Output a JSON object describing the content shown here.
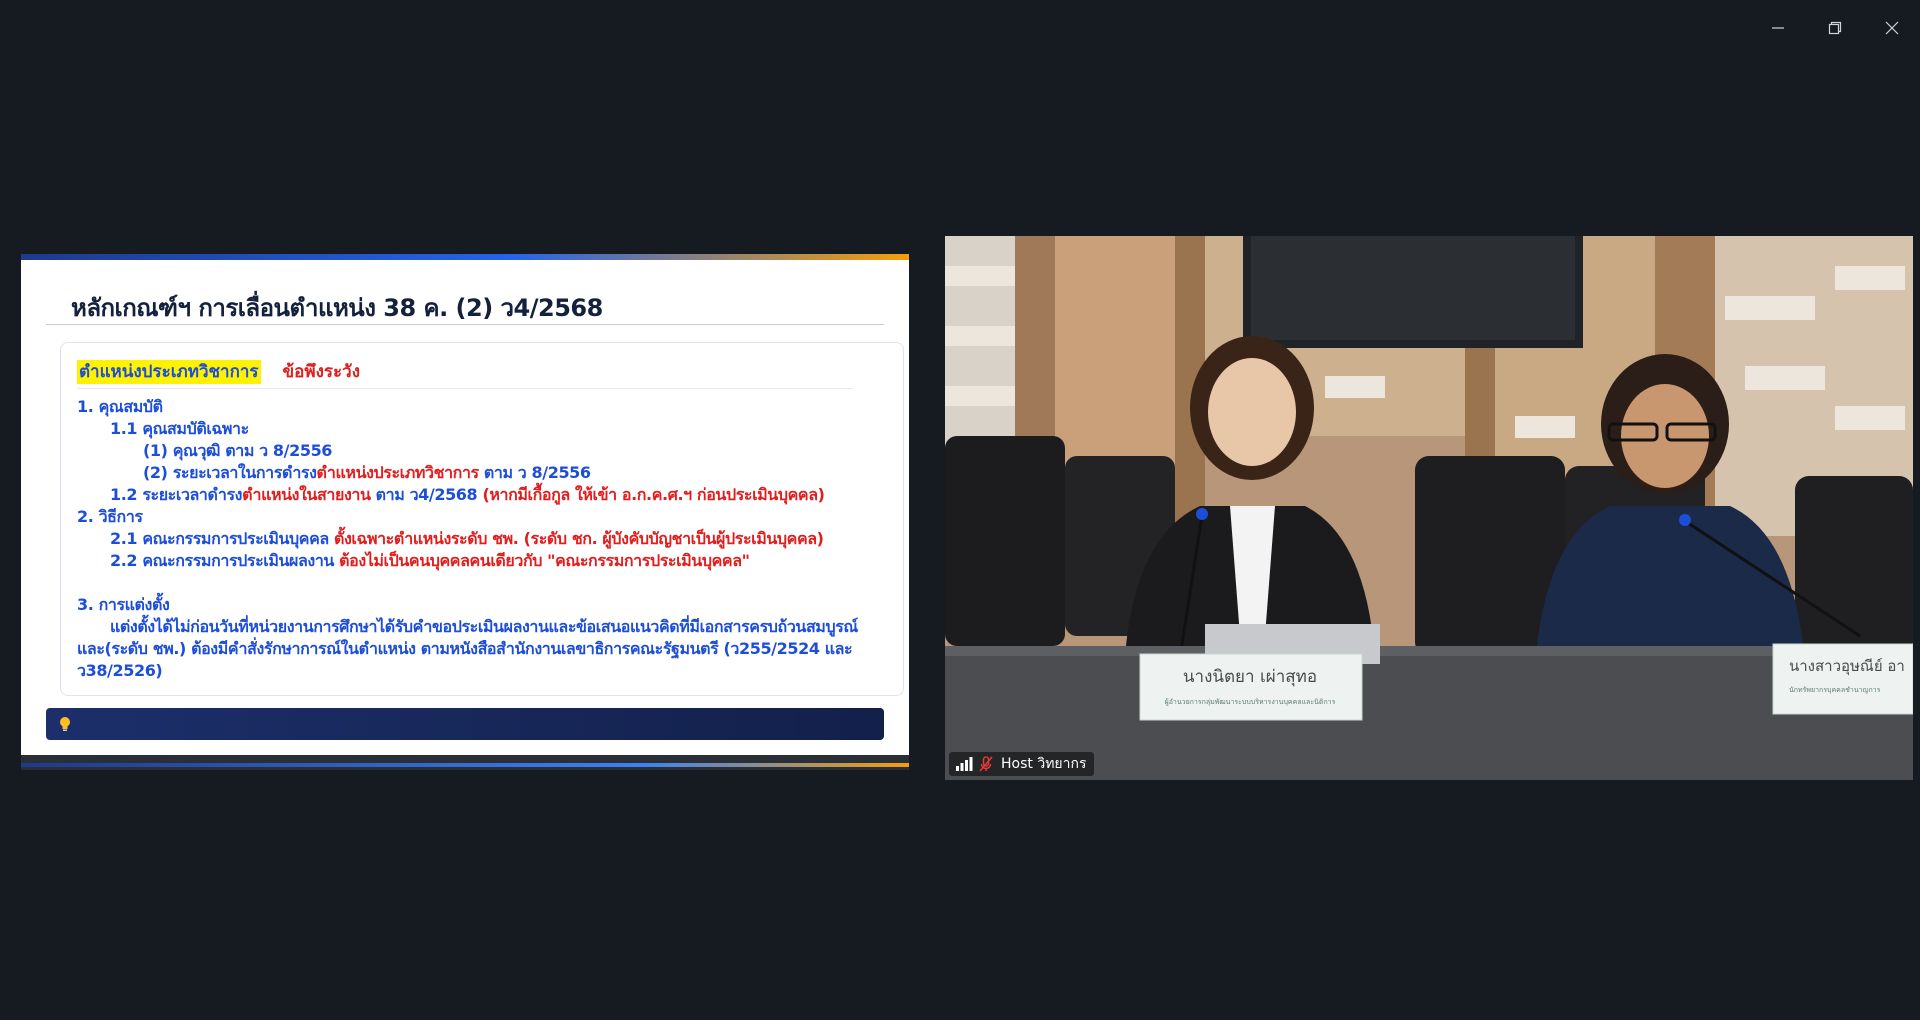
{
  "window": {
    "controls": {
      "minimize": "minimize-icon",
      "restore": "restore-icon",
      "close": "close-icon"
    }
  },
  "slide": {
    "title": "หลักเกณฑ์ฯ การเลื่อนตำแหน่ง 38 ค. (2) ว4/2568",
    "tab_active": "ตำแหน่งประเภทวิชาการ",
    "tab_warn": "ข้อพึงระวัง",
    "items": {
      "q1": "1. คุณสมบัติ",
      "q1_1": "1.1 คุณสมบัติเฉพาะ",
      "q1_1_a": "(1) คุณวุฒิ ตาม ว 8/2556",
      "q1_1_b_pre": "(2) ระยะเวลาในการดำรง",
      "q1_1_b_red": "ตำแหน่งประเภทวิชาการ",
      "q1_1_b_post": " ตาม ว 8/2556",
      "q1_2_pre": "1.2 ระยะเวลาดำรง",
      "q1_2_red": "ตำแหน่งในสายงาน",
      "q1_2_mid": " ตาม ว4/2568 ",
      "q1_2_red2": "(หากมีเกื้อกูล ให้เข้า อ.ก.ค.ศ.ฯ ก่อนประเมินบุคคล)",
      "q2": "2. วิธีการ",
      "q2_1_pre": "2.1 คณะกรรมการประเมินบุคคล  ",
      "q2_1_red": "ตั้งเฉพาะตำแหน่งระดับ  ชพ. (ระดับ ชก. ผู้บังคับบัญชาเป็นผู้ประเมินบุคคล)",
      "q2_2_pre": "2.2 คณะกรรมการประเมินผลงาน ",
      "q2_2_red": "ต้องไม่เป็นคนบุคคลคนเดียวกับ \"คณะกรรมการประเมินบุคคล\"",
      "q3": "3. การแต่งตั้ง",
      "q3_text": "แต่งตั้งได้ไม่ก่อนวันที่หน่วยงานการศึกษาได้รับคำขอประเมินผลงานและข้อเสนอแนวคิดที่มีเอกสารครบถ้วนสมบูรณ์ และ(ระดับ ชพ.) ต้องมีคำสั่งรักษาการณ์ในตำแหน่ง ตามหนังสือสำนักงานเลขาธิการคณะรัฐมนตรี (ว255/2524 และ ว38/2526)"
    },
    "tip_icon": "lightbulb-icon"
  },
  "video": {
    "nameplate_left": "นางนิตยา  เผ่าสุทอ",
    "nameplate_left_sub": "ผู้อำนวยการกลุ่มพัฒนาระบบบริหารงานบุคคลและนิติการ",
    "nameplate_right": "นางสาวอุษณีย์  อา",
    "nameplate_right_sub": "นักทรัพยากรบุคคลชำนาญการ",
    "speaker_label": "Host วิทยากร",
    "signal_icon": "signal-bars-icon",
    "mic_icon": "mic-muted-icon"
  },
  "colors": {
    "background": "#161b22",
    "slide_blue": "#1d4ed8",
    "slide_red": "#e11d1d",
    "highlight": "#fff200"
  }
}
